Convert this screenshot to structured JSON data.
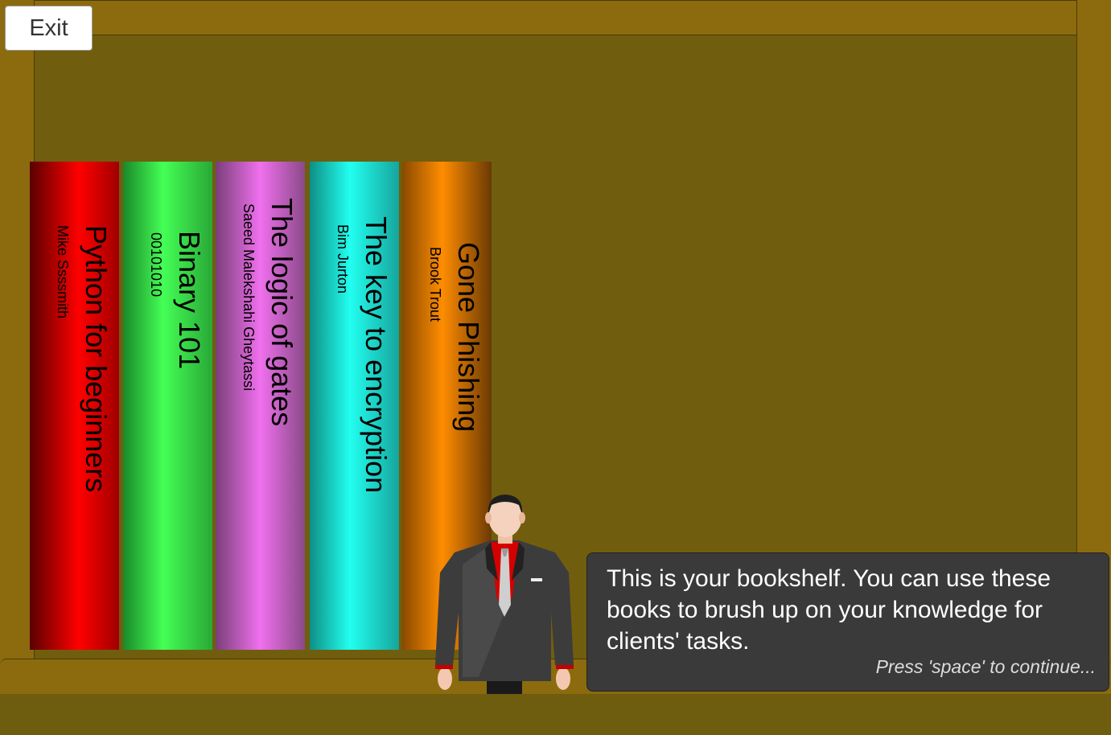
{
  "exit_label": "Exit",
  "books": [
    {
      "title": "Python for beginners",
      "author": "Mike Ssssmith",
      "color": "#ff0000"
    },
    {
      "title": "Binary 101",
      "author": "00101010",
      "color": "#44ff55"
    },
    {
      "title": "The logic of gates",
      "author": "Saeed Malekshahi Gheytassi",
      "color": "#f070ee"
    },
    {
      "title": "The key to encryption",
      "author": "Bim Jurton",
      "color": "#22fff0"
    },
    {
      "title": "Gone Phishing",
      "author": "Brook Trout",
      "color": "#ff8c00"
    }
  ],
  "dialog": {
    "message": "This is your bookshelf. You can use these books to brush up on your knowledge for clients' tasks.",
    "hint": "Press 'space' to continue..."
  }
}
